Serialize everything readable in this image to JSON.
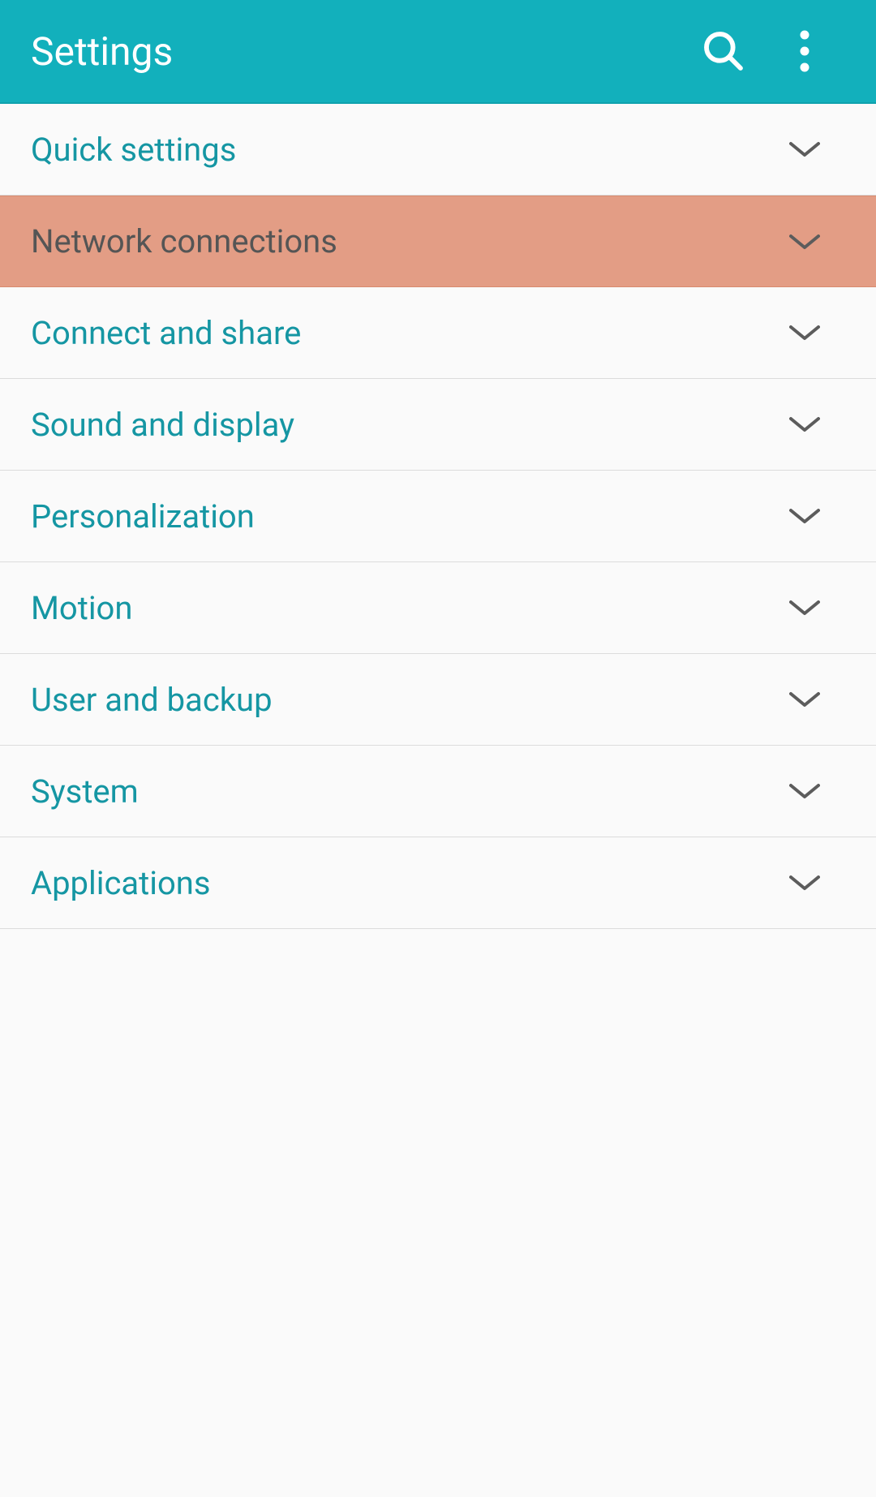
{
  "header": {
    "title": "Settings"
  },
  "categories": [
    {
      "label": "Quick settings",
      "highlighted": false
    },
    {
      "label": "Network connections",
      "highlighted": true
    },
    {
      "label": "Connect and share",
      "highlighted": false
    },
    {
      "label": "Sound and display",
      "highlighted": false
    },
    {
      "label": "Personalization",
      "highlighted": false
    },
    {
      "label": "Motion",
      "highlighted": false
    },
    {
      "label": "User and backup",
      "highlighted": false
    },
    {
      "label": "System",
      "highlighted": false
    },
    {
      "label": "Applications",
      "highlighted": false
    }
  ],
  "colors": {
    "accent": "#12b0bc",
    "highlight": "#e39d85",
    "link": "#1596a3"
  }
}
